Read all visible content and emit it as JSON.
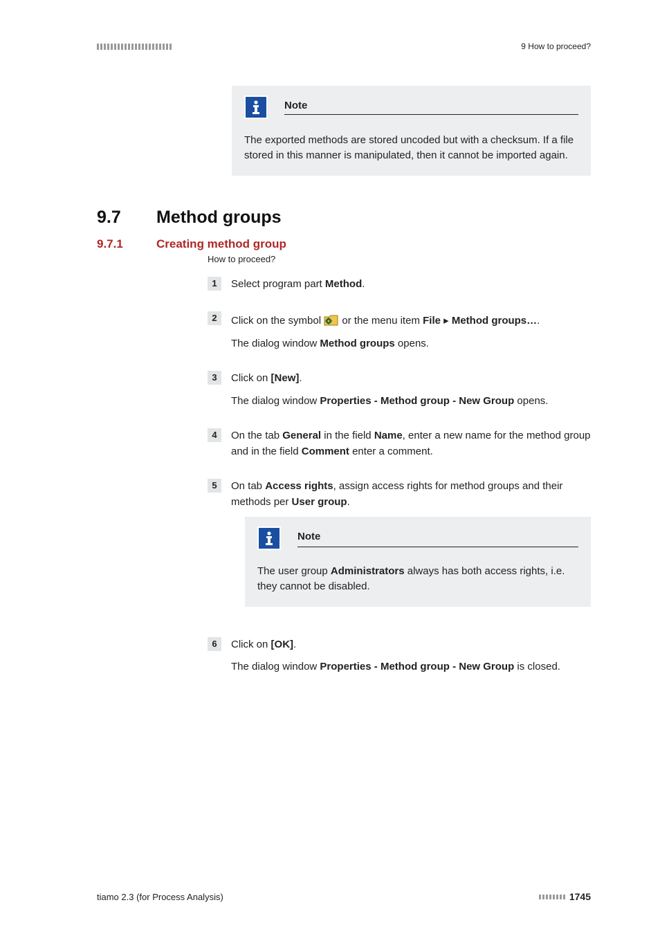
{
  "header": {
    "breadcrumb": "9 How to proceed?"
  },
  "noteTop": {
    "label": "Note",
    "body": "The exported methods are stored uncoded but with a checksum. If a file stored in this manner is manipulated, then it cannot be imported again."
  },
  "section": {
    "num": "9.7",
    "title": "Method groups"
  },
  "subsection": {
    "num": "9.7.1",
    "title": "Creating method group"
  },
  "lead": "How to proceed?",
  "steps": {
    "s1": {
      "num": "1",
      "pre": "Select program part ",
      "b1": "Method",
      "post": "."
    },
    "s2": {
      "num": "2",
      "p1_pre": "Click on the symbol ",
      "p1_mid": " or the menu item ",
      "p1_b1": "File",
      "p1_sep": " ▸ ",
      "p1_b2": "Method groups…",
      "p1_post": ".",
      "p2_pre": "The dialog window ",
      "p2_b1": "Method groups",
      "p2_post": " opens."
    },
    "s3": {
      "num": "3",
      "p1_pre": "Click on ",
      "p1_b1": "[New]",
      "p1_post": ".",
      "p2_pre": "The dialog window ",
      "p2_b1": "Properties - Method group - New Group",
      "p2_post": " opens."
    },
    "s4": {
      "num": "4",
      "pre": "On the tab ",
      "b1": "General",
      "mid1": " in the field ",
      "b2": "Name",
      "mid2": ", enter a new name for the method group and in the field ",
      "b3": "Comment",
      "post": " enter a comment."
    },
    "s5": {
      "num": "5",
      "p1_pre": "On tab ",
      "p1_b1": "Access rights",
      "p1_mid": ", assign access rights for method groups and their methods per ",
      "p1_b2": "User group",
      "p1_post": ".",
      "note_label": "Note",
      "note_pre": "The user group ",
      "note_b1": "Administrators",
      "note_post": " always has both access rights, i.e. they cannot be disabled."
    },
    "s6": {
      "num": "6",
      "p1_pre": "Click on ",
      "p1_b1": "[OK]",
      "p1_post": ".",
      "p2_pre": "The dialog window ",
      "p2_b1": "Properties - Method group - New Group",
      "p2_post": " is closed."
    }
  },
  "footer": {
    "product": "tiamo 2.3 (for Process Analysis)",
    "page": "1745"
  }
}
